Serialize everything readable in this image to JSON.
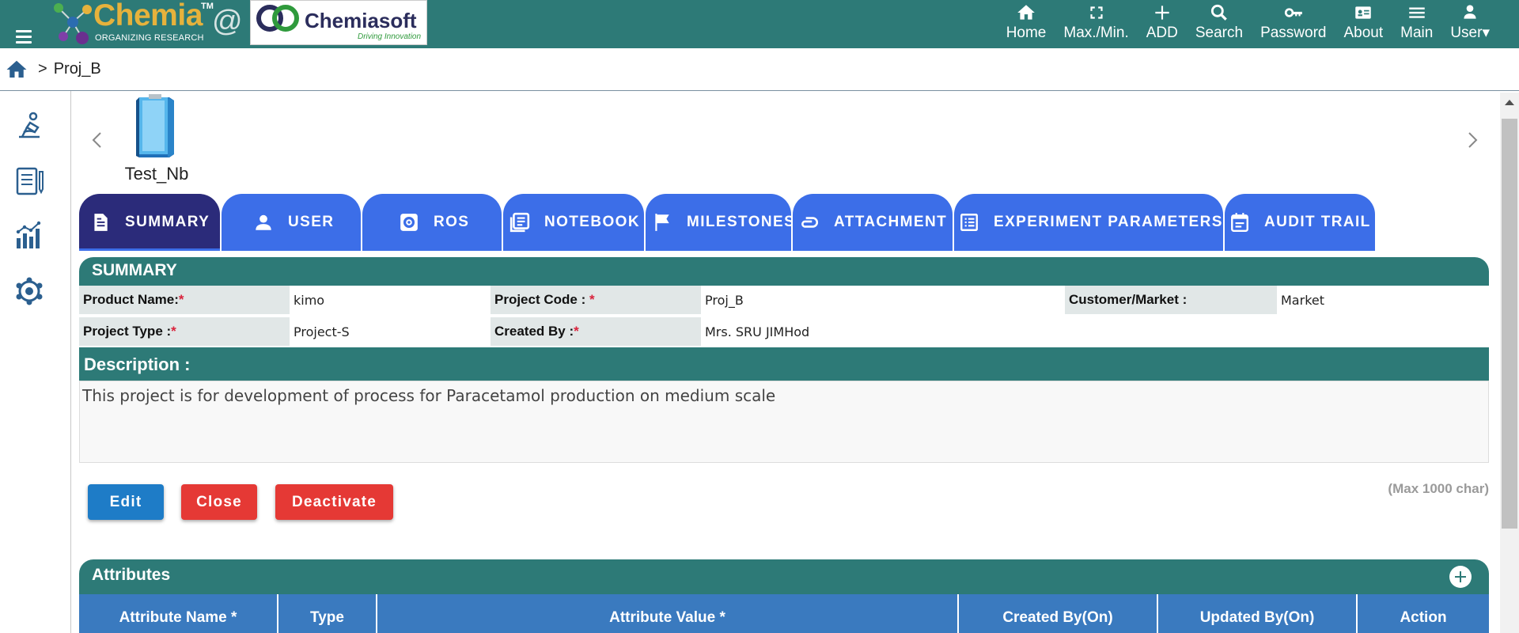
{
  "header": {
    "brand": {
      "name": "Chemia",
      "trademark": "TM",
      "tagline": "ORGANIZING RESEARCH",
      "at_symbol": "@"
    },
    "partner": {
      "name": "Chemiasoft",
      "tagline": "Driving Innovation"
    },
    "nav": [
      {
        "label": "Home",
        "icon": "home-icon"
      },
      {
        "label": "Max./Min.",
        "icon": "fullscreen-icon"
      },
      {
        "label": "ADD",
        "icon": "plus-icon"
      },
      {
        "label": "Search",
        "icon": "search-icon"
      },
      {
        "label": "Password",
        "icon": "key-icon"
      },
      {
        "label": "About",
        "icon": "id-card-icon"
      },
      {
        "label": "Main",
        "icon": "menu-icon"
      },
      {
        "label": "User",
        "icon": "user-icon"
      }
    ],
    "user_caret": "▾"
  },
  "breadcrumb": {
    "separator": ">",
    "current": "Proj_B"
  },
  "sidebar": {
    "icons": [
      "microscope-icon",
      "notebook-icon",
      "analytics-chart-icon",
      "settings-network-icon"
    ]
  },
  "notebooks": {
    "items": [
      {
        "label": "Test_Nb",
        "icon": "notebook-book-icon"
      }
    ]
  },
  "tabs": [
    {
      "label": "SUMMARY",
      "icon": "document-icon",
      "active": true
    },
    {
      "label": "USER",
      "icon": "person-icon",
      "active": false
    },
    {
      "label": "ROS",
      "icon": "gear-box-icon",
      "active": false
    },
    {
      "label": "NOTEBOOK",
      "icon": "notebook-list-icon",
      "active": false
    },
    {
      "label": "MILESTONES",
      "icon": "flag-icon",
      "active": false
    },
    {
      "label": "ATTACHMENT",
      "icon": "paperclip-icon",
      "active": false
    },
    {
      "label": "EXPERIMENT PARAMETERS",
      "icon": "list-box-icon",
      "active": false
    },
    {
      "label": "AUDIT TRAIL",
      "icon": "calendar-icon",
      "active": false
    }
  ],
  "summary": {
    "title": "SUMMARY",
    "required_mark": "*",
    "fields": {
      "product_name": {
        "label": "Product Name:",
        "value": "kimo"
      },
      "project_code": {
        "label": "Project Code : ",
        "value": "Proj_B"
      },
      "customer_market": {
        "label": "Customer/Market :",
        "value": "Market"
      },
      "project_type": {
        "label": "Project Type :",
        "value": "Project-S"
      },
      "created_by": {
        "label": "Created By :",
        "value": "Mrs. SRU JIMHod"
      }
    },
    "description_title": "Description :",
    "description": "This project is for development of process for Paracetamol production on medium scale",
    "max_char": "(Max 1000 char)",
    "buttons": {
      "edit": "Edit",
      "close": "Close",
      "deactivate": "Deactivate"
    }
  },
  "attributes": {
    "title": "Attributes",
    "columns": [
      "Attribute Name *",
      "Type",
      "Attribute Value *",
      "Created By(On)",
      "Updated By(On)",
      "Action"
    ]
  },
  "colors": {
    "teal": "#2d7a77",
    "tab_blue": "#3c6ee8",
    "tab_active": "#2b2b7a",
    "edit_blue": "#1e7cc7",
    "danger_red": "#e53935",
    "table_header": "#3a7abf"
  }
}
